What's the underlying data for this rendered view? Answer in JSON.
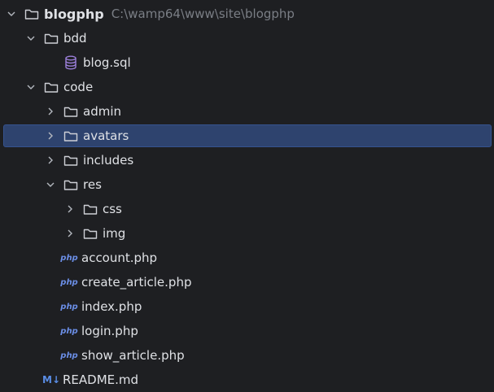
{
  "project": {
    "name": "blogphp",
    "path": "C:\\wamp64\\www\\site\\blogphp"
  },
  "folders": {
    "bdd": "bdd",
    "code": "code",
    "admin": "admin",
    "avatars": "avatars",
    "includes": "includes",
    "res": "res",
    "css": "css",
    "img": "img"
  },
  "files": {
    "blog_sql": "blog.sql",
    "account_php": "account.php",
    "create_article_php": "create_article.php",
    "index_php": "index.php",
    "login_php": "login.php",
    "show_article_php": "show_article.php",
    "readme_md": "README.md"
  },
  "icons": {
    "php_badge": "php",
    "md_badge": "M↓"
  },
  "selected": "avatars",
  "colors": {
    "background": "#1e1f22",
    "selection": "#2e436e",
    "text": "#dfe1e5",
    "muted": "#7a7e85",
    "php": "#6b8ee6",
    "database": "#9b7fd9"
  }
}
